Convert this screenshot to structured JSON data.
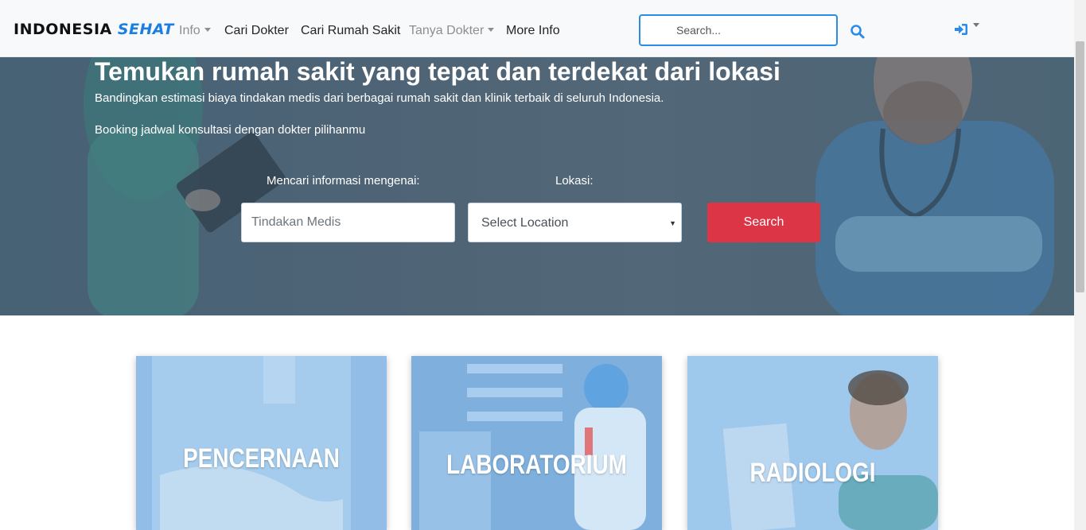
{
  "navbar": {
    "brand_part1": "INDONESIA",
    "brand_part2": "SEHAT",
    "links": {
      "info": "Info",
      "cari_dokter": "Cari Dokter",
      "cari_rumah_sakit": "Cari Rumah Sakit",
      "tanya_dokter": "Tanya Dokter",
      "more_info": "More Info"
    },
    "search_placeholder": "Search...",
    "icons": {
      "search": "search-icon",
      "login": "sign-in-icon"
    }
  },
  "hero": {
    "title": "Temukan rumah sakit yang tepat dan terdekat dari lokasi",
    "subtitle": "Bandingkan estimasi biaya tindakan medis dari berbagai rumah sakit dan klinik terbaik di seluruh Indonesia.",
    "subtitle2": "Booking jadwal konsultasi dengan dokter pilihanmu",
    "query_label": "Mencari informasi mengenai:",
    "location_label": "Lokasi:",
    "query_placeholder": "Tindakan Medis",
    "location_selected": "Select Location",
    "search_button": "Search"
  },
  "cards": [
    {
      "title": "PENCERNAAN"
    },
    {
      "title": "LABORATORIUM"
    },
    {
      "title": "RADIOLOGI"
    }
  ],
  "colors": {
    "brand_accent": "#1a7fe0",
    "primary_blue": "#2b8be8",
    "search_red": "#dc3545",
    "navbar_bg": "#f8f9fa",
    "card_overlay": "#8fc3ef"
  }
}
